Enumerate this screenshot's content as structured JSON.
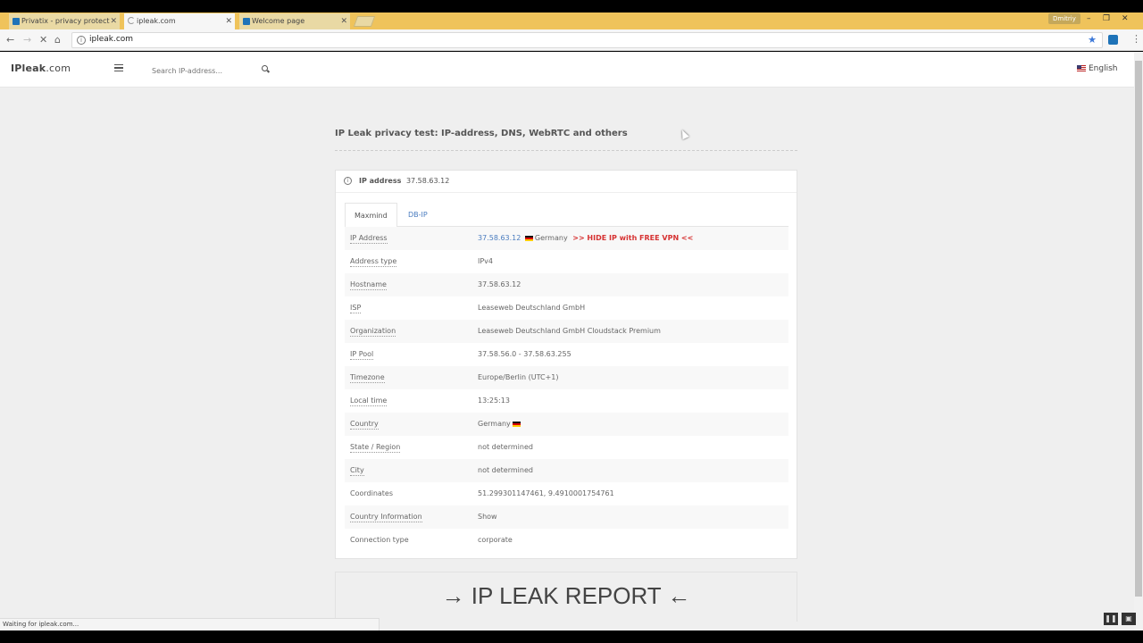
{
  "browser": {
    "tabs": [
      {
        "title": "Privatix - privacy protect",
        "icon": "privatix-icon"
      },
      {
        "title": "ipleak.com",
        "icon": "loading-spinner-icon"
      },
      {
        "title": "Welcome page",
        "icon": "privatix-icon"
      }
    ],
    "user": "Dmitriy",
    "url": "ipleak.com",
    "status": "Waiting for ipleak.com...",
    "accent": "#efc35b"
  },
  "site": {
    "logo_main": "IPleak",
    "logo_domain": ".com",
    "search_placeholder": "Search IP-address...",
    "language": "English"
  },
  "main": {
    "title": "IP Leak privacy test: IP-address, DNS, WebRTC and others",
    "card_title": "IP address",
    "card_ip": "37.58.63.12",
    "tabs": [
      "Maxmind",
      "DB-IP"
    ],
    "rows": [
      {
        "key": "IP Address",
        "value": "37.58.63.12",
        "country": "Germany",
        "promo": ">> HIDE IP with FREE VPN <<"
      },
      {
        "key": "Address type",
        "value": "IPv4"
      },
      {
        "key": "Hostname",
        "value": "37.58.63.12"
      },
      {
        "key": "ISP",
        "value": "Leaseweb Deutschland GmbH"
      },
      {
        "key": "Organization",
        "value": "Leaseweb Deutschland GmbH Cloudstack Premium"
      },
      {
        "key": "IP Pool",
        "value": "37.58.56.0 - 37.58.63.255"
      },
      {
        "key": "Timezone",
        "value": "Europe/Berlin (UTC+1)"
      },
      {
        "key": "Local time",
        "value": "13:25:13"
      },
      {
        "key": "Country",
        "value": "Germany"
      },
      {
        "key": "State / Region",
        "value": "not determined"
      },
      {
        "key": "City",
        "value": "not determined"
      },
      {
        "key": "Coordinates",
        "value": "51.299301147461, 9.4910001754761"
      },
      {
        "key": "Country Information",
        "value": "Show"
      },
      {
        "key": "Connection type",
        "value": "corporate"
      }
    ],
    "report_label": "→ IP LEAK REPORT ←"
  }
}
